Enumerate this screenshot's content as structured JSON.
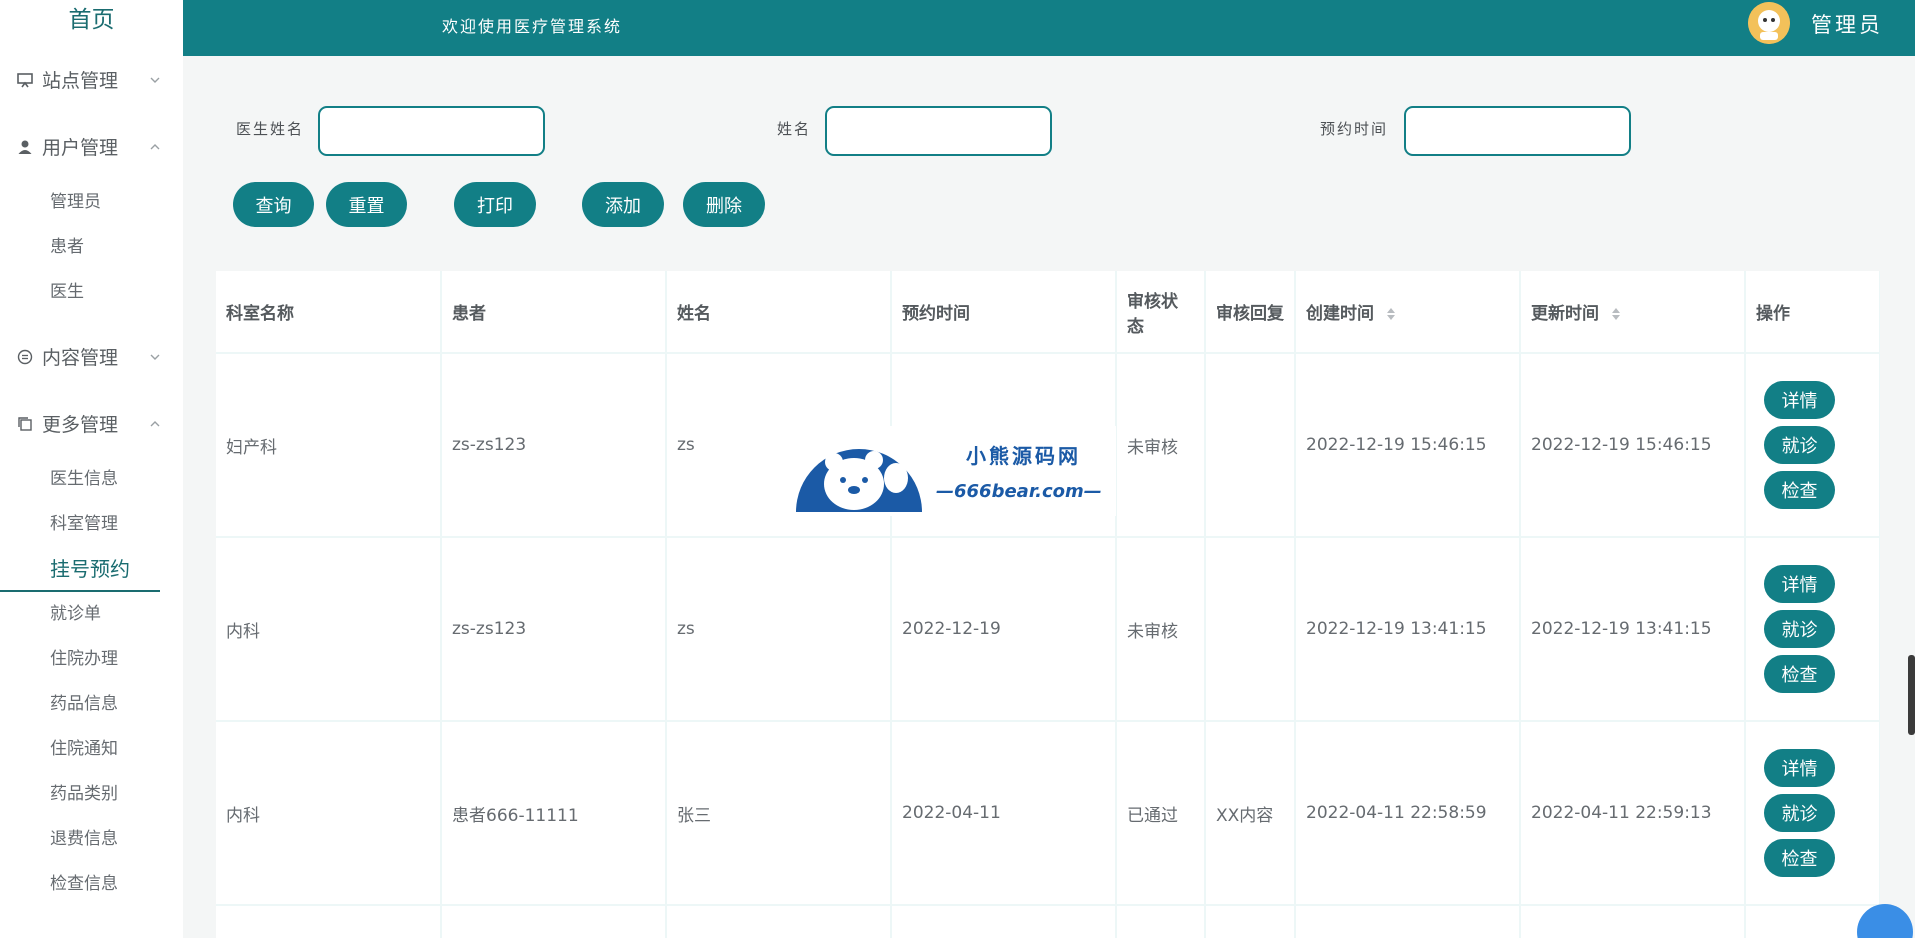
{
  "sidebar": {
    "home": "首页",
    "groups": {
      "site": "站点管理",
      "user": "用户管理",
      "content": "内容管理",
      "more": "更多管理"
    },
    "user_items": [
      "管理员",
      "患者",
      "医生"
    ],
    "more_items": [
      "医生信息",
      "科室管理",
      "挂号预约",
      "就诊单",
      "住院办理",
      "药品信息",
      "住院通知",
      "药品类别",
      "退费信息",
      "检查信息"
    ],
    "active_item": "挂号预约"
  },
  "header": {
    "welcome": "欢迎使用医疗管理系统",
    "admin": "管理员"
  },
  "search": {
    "doctor_label": "医生姓名",
    "name_label": "姓名",
    "time_label": "预约时间",
    "doctor_value": "",
    "name_value": "",
    "time_value": ""
  },
  "toolbar": {
    "query": "查询",
    "reset": "重置",
    "print": "打印",
    "add": "添加",
    "delete": "删除"
  },
  "table": {
    "headers": [
      "科室名称",
      "患者",
      "姓名",
      "预约时间",
      "审核状态",
      "审核回复",
      "创建时间",
      "更新时间",
      "操作"
    ],
    "rows": [
      [
        "妇产科",
        "zs-zs123",
        "zs",
        "",
        "未审核",
        "",
        "2022-12-19 15:46:15",
        "2022-12-19 15:46:15"
      ],
      [
        "内科",
        "zs-zs123",
        "zs",
        "2022-12-19",
        "未审核",
        "",
        "2022-12-19 13:41:15",
        "2022-12-19 13:41:15"
      ],
      [
        "内科",
        "患者666-11111",
        "张三",
        "2022-04-11",
        "已通过",
        "XX内容",
        "2022-04-11 22:58:59",
        "2022-04-11 22:59:13"
      ]
    ],
    "actions": [
      "详情",
      "就诊",
      "检查"
    ]
  },
  "watermark": {
    "title": "小熊源码网",
    "url": "—666bear.com—"
  },
  "colors": {
    "primary": "#127f86",
    "sidebar_active": "#1a6c70"
  }
}
